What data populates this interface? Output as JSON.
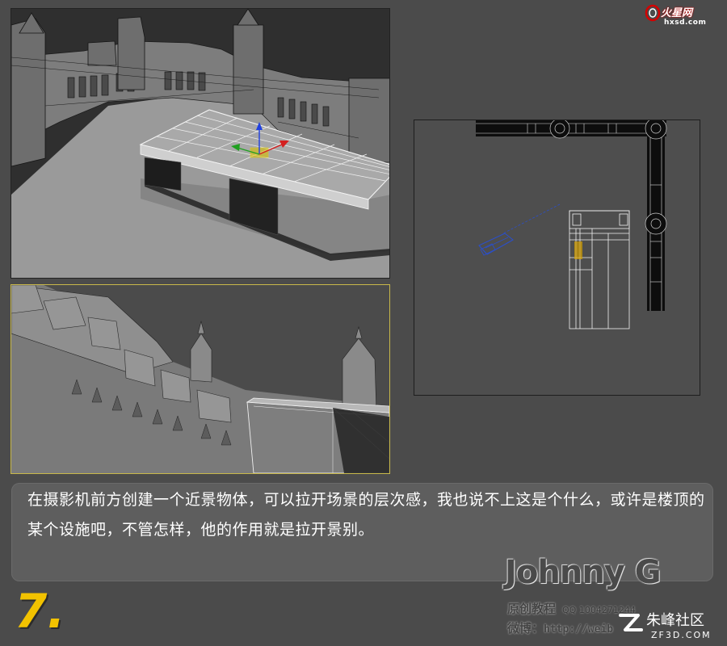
{
  "caption": {
    "text": "在摄影机前方创建一个近景物体，可以拉开场景的层次感，我也说不上这是个什么，或许是楼顶的某个设施吧，不管怎样，他的作用就是拉开景别。"
  },
  "step": {
    "number": "7."
  },
  "author": {
    "name": "Johnny G",
    "tag": "原创教程",
    "qq": "QQ 1004271244",
    "weibo_label": "微博：",
    "weibo_url": "http://weib"
  },
  "watermarks": {
    "top_brand": "火星网",
    "top_url": "hxsd.com",
    "bottom_name": "朱峰社区",
    "bottom_url": "ZF3D.COM"
  },
  "colors": {
    "background": "#4b4b4b",
    "caption_box": "#5e5e5e",
    "step_number": "#f2c200",
    "camera_viewport_border": "#c8b84a",
    "gizmo_x": "#d42020",
    "gizmo_y": "#20a020",
    "gizmo_z": "#2040e0",
    "camera_icon": "#2b4fc8"
  },
  "viewports": {
    "perspective": {
      "icon": "transform-gizmo-icon"
    },
    "camera": {},
    "top": {
      "icon": "camera-object-icon"
    }
  }
}
